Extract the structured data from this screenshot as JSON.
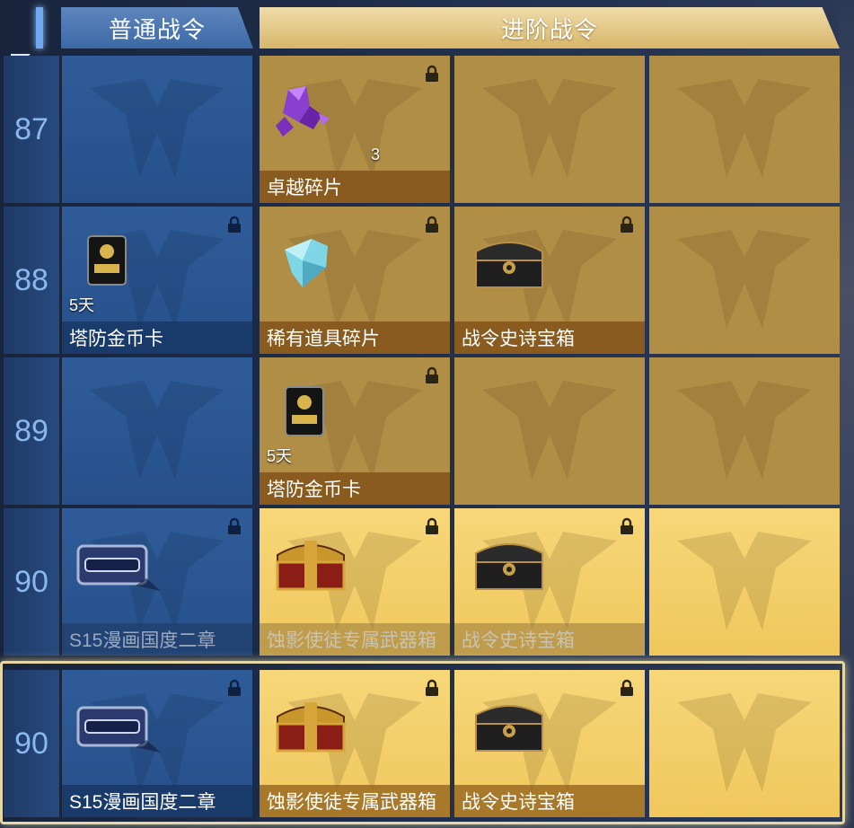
{
  "header": {
    "normal_tab": "普通战令",
    "advanced_tab": "进阶战令"
  },
  "colors": {
    "normal_track": "#2f5c99",
    "advanced_track": "#b08e46",
    "advanced_highlight": "#f0c75c"
  },
  "rows": [
    {
      "level": "87",
      "normal": {
        "name": "",
        "qty": "",
        "locked": false,
        "icon": ""
      },
      "advanced": [
        {
          "name": "卓越碎片",
          "qty": "3",
          "locked": true,
          "icon": "purple-crystal-shard-icon"
        },
        {
          "name": "",
          "qty": "",
          "locked": false,
          "icon": ""
        },
        {
          "name": "",
          "qty": "",
          "locked": false,
          "icon": ""
        }
      ]
    },
    {
      "level": "88",
      "normal": {
        "name": "塔防金币卡",
        "qty": "5天",
        "locked": true,
        "icon": "gold-coin-card-icon"
      },
      "advanced": [
        {
          "name": "稀有道具碎片",
          "qty": "",
          "locked": true,
          "icon": "rare-item-shard-icon"
        },
        {
          "name": "战令史诗宝箱",
          "qty": "",
          "locked": true,
          "icon": "epic-chest-icon"
        },
        {
          "name": "",
          "qty": "",
          "locked": false,
          "icon": ""
        }
      ]
    },
    {
      "level": "89",
      "normal": {
        "name": "",
        "qty": "",
        "locked": false,
        "icon": ""
      },
      "advanced": [
        {
          "name": "塔防金币卡",
          "qty": "5天",
          "locked": true,
          "icon": "gold-coin-card-icon"
        },
        {
          "name": "",
          "qty": "",
          "locked": false,
          "icon": ""
        },
        {
          "name": "",
          "qty": "",
          "locked": false,
          "icon": ""
        }
      ]
    },
    {
      "level": "90",
      "normal": {
        "name": "S15漫画国度二章",
        "qty": "",
        "locked": true,
        "icon": "comic-chest-icon"
      },
      "advanced": [
        {
          "name": "蚀影使徒专属武器箱",
          "qty": "",
          "locked": true,
          "icon": "exclusive-weapon-chest-icon"
        },
        {
          "name": "战令史诗宝箱",
          "qty": "",
          "locked": true,
          "icon": "epic-chest-icon"
        },
        {
          "name": "",
          "qty": "",
          "locked": false,
          "icon": ""
        }
      ]
    }
  ],
  "pinned_row": {
    "level": "90",
    "normal": {
      "name": "S15漫画国度二章",
      "qty": "",
      "locked": true,
      "icon": "comic-chest-icon"
    },
    "advanced": [
      {
        "name": "蚀影使徒专属武器箱",
        "qty": "",
        "locked": true,
        "icon": "exclusive-weapon-chest-icon"
      },
      {
        "name": "战令史诗宝箱",
        "qty": "",
        "locked": true,
        "icon": "epic-chest-icon"
      },
      {
        "name": "",
        "qty": "",
        "locked": false,
        "icon": ""
      }
    ]
  }
}
